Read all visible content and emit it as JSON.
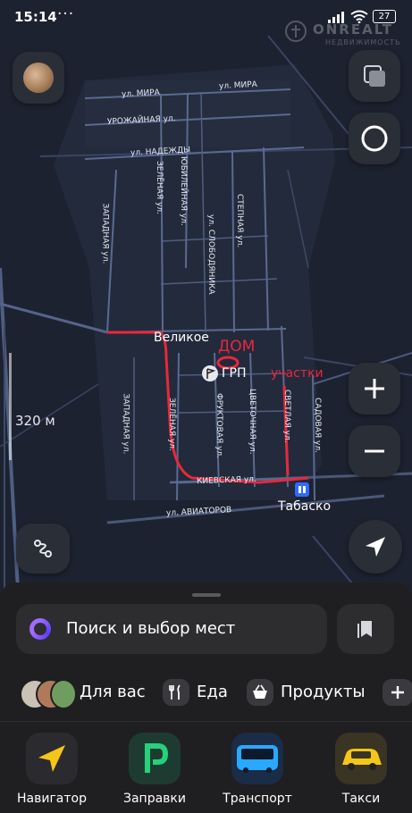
{
  "status_bar": {
    "time": "15:14",
    "dots": "···",
    "battery": "27"
  },
  "watermark": {
    "brand": "ONREALT",
    "sub": "НЕДВИЖИМОСТЬ"
  },
  "map": {
    "streets": {
      "mira_1": "ул. МИРА",
      "mira_2": "ул. МИРА",
      "urozhaynaya": "УРОЖАЙНАЯ ул.",
      "nadezhdy": "ул. НАДЕЖДЫ",
      "zelenaya_top": "ЗЕЛЁНАЯ ул.",
      "yubileynaya": "ЮБИЛЕЙНАЯ ул.",
      "zapadnaya_top": "ЗАПАДНАЯ ул.",
      "slobodyanika": "ул. СЛОБОДЯНИКА",
      "stepnaya": "СТЕПНАЯ ул.",
      "zapadnaya_bottom": "ЗАПАДНАЯ ул.",
      "zelenaya_bottom": "ЗЕЛЁНАЯ ул.",
      "fruktovaya": "ФРУКТОВАЯ ул.",
      "tsvetochnaya": "ЦВЕТОЧНАЯ ул.",
      "svetlaya": "СВЕТЛАЯ ул.",
      "sadovaya": "САДОВАЯ ул.",
      "kievskaya": "КИЕВСКАЯ ул.",
      "aviatorov": "ул. АВИАТОРОВ"
    },
    "places": {
      "village": "Великое",
      "grp": "ГРП",
      "shop": "Табаско"
    },
    "annotations": {
      "dom": "ДОМ",
      "uchastki": "участки"
    },
    "scale": "320 м"
  },
  "search": {
    "placeholder": "Поиск и выбор мест"
  },
  "categories": [
    {
      "label": "Для вас",
      "icon": "for-you-avatars-icon"
    },
    {
      "label": "Еда",
      "icon": "fork-knife-icon"
    },
    {
      "label": "Продукты",
      "icon": "basket-icon"
    }
  ],
  "apps": [
    {
      "label": "Навигатор",
      "icon": "navigator-arrow-icon",
      "color": "#f5c518"
    },
    {
      "label": "Заправки",
      "icon": "fuel-p-icon",
      "color": "#27d07a"
    },
    {
      "label": "Транспорт",
      "icon": "bus-icon",
      "color": "#2aa8ff"
    },
    {
      "label": "Такси",
      "icon": "taxi-car-icon",
      "color": "#f5c518"
    }
  ],
  "colors": {
    "map_bg": "#1d2230",
    "road": "#5b6a8c",
    "annotation_red": "#e8283c",
    "transport_blue": "#2f6bff"
  }
}
